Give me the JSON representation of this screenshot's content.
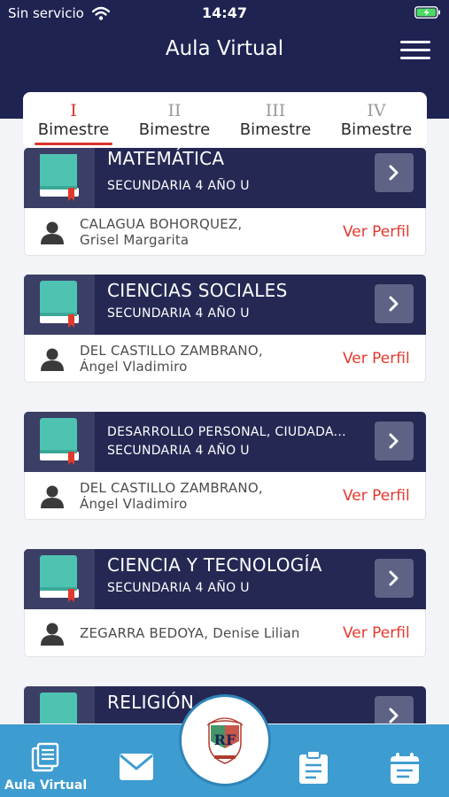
{
  "status_bar": {
    "carrier": "Sin servicio",
    "time": "14:47"
  },
  "header": {
    "title": "Aula Virtual",
    "menu_icon": "hamburger-menu-icon"
  },
  "tabs": [
    {
      "numeral": "I",
      "label": "Bimestre",
      "active": true
    },
    {
      "numeral": "II",
      "label": "Bimestre",
      "active": false
    },
    {
      "numeral": "III",
      "label": "Bimestre",
      "active": false
    },
    {
      "numeral": "IV",
      "label": "Bimestre",
      "active": false
    }
  ],
  "courses": [
    {
      "name": "MATEMÁTICA",
      "grade": "SECUNDARIA 4 AÑO U",
      "teacher_line1": "CALAGUA BOHORQUEZ,",
      "teacher_line2": "Grisel Margarita",
      "profile_label": "Ver Perfil"
    },
    {
      "name": "CIENCIAS SOCIALES",
      "grade": "SECUNDARIA 4 AÑO U",
      "teacher_line1": "DEL CASTILLO ZAMBRANO,",
      "teacher_line2": "Ángel Vladimiro",
      "profile_label": "Ver Perfil"
    },
    {
      "name": "DESARROLLO PERSONAL, CIUDADA...",
      "grade": "SECUNDARIA 4 AÑO U",
      "teacher_line1": "DEL CASTILLO ZAMBRANO,",
      "teacher_line2": "Ángel Vladimiro",
      "profile_label": "Ver Perfil"
    },
    {
      "name": "CIENCIA Y TECNOLOGÍA",
      "grade": "SECUNDARIA 4 AÑO U",
      "teacher_line1": "ZEGARRA BEDOYA, Denise Lilian",
      "teacher_line2": "",
      "profile_label": "Ver Perfil"
    },
    {
      "name": "RELIGIÓN",
      "grade": "",
      "teacher_line1": "",
      "teacher_line2": "",
      "profile_label": ""
    }
  ],
  "bottom_nav": {
    "items": [
      {
        "label": "Aula Virtual",
        "icon": "book-list-icon"
      },
      {
        "label": "",
        "icon": "mail-icon"
      },
      {
        "label": "",
        "icon": "clipboard-icon"
      },
      {
        "label": "",
        "icon": "calendar-icon"
      }
    ],
    "center_logo": "school-crest-icon"
  },
  "colors": {
    "header_bg": "#1f2352",
    "card_header_bg": "#252853",
    "accent_red": "#e2382d",
    "bottom_nav_bg": "#3d9cd0",
    "book_teal": "#4fc3b2"
  }
}
